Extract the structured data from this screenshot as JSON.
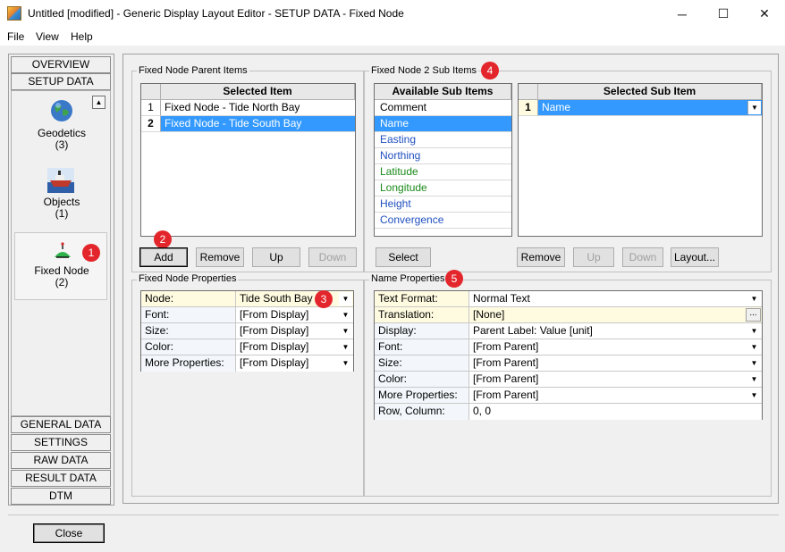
{
  "window": {
    "title": "Untitled [modified] - Generic Display Layout Editor -  SETUP DATA -  Fixed Node",
    "minimize": "─",
    "maximize": "☐",
    "close": "✕"
  },
  "menu": [
    "File",
    "View",
    "Help"
  ],
  "nav": {
    "top_tabs": [
      "OVERVIEW",
      "SETUP DATA"
    ],
    "items": [
      {
        "label": "Geodetics",
        "count": "(3)"
      },
      {
        "label": "Objects",
        "count": "(1)"
      },
      {
        "label": "Fixed Node",
        "count": "(2)"
      }
    ],
    "bottom_tabs": [
      "GENERAL DATA",
      "SETTINGS",
      "RAW DATA",
      "RESULT DATA",
      "DTM"
    ]
  },
  "badges": [
    "1",
    "2",
    "3",
    "4",
    "5"
  ],
  "parent_items": {
    "label": "Fixed Node Parent Items",
    "header": "Selected Item",
    "rows": [
      {
        "num": "1",
        "text": "Fixed Node  -  Tide North Bay"
      },
      {
        "num": "2",
        "text": "Fixed Node  -  Tide South Bay"
      }
    ],
    "buttons": {
      "add": "Add",
      "remove": "Remove",
      "up": "Up",
      "down": "Down"
    }
  },
  "sub_items": {
    "label": "Fixed Node 2 Sub Items",
    "available_header": "Available Sub Items",
    "available": [
      {
        "text": "Comment",
        "color": "#000000"
      },
      {
        "text": "Name",
        "color": "#ffffff"
      },
      {
        "text": "Easting",
        "color": "#2050c0"
      },
      {
        "text": "Northing",
        "color": "#2050c0"
      },
      {
        "text": "Latitude",
        "color": "#1a8a1a"
      },
      {
        "text": "Longitude",
        "color": "#1a8a1a"
      },
      {
        "text": "Height",
        "color": "#2050c0"
      },
      {
        "text": "Convergence",
        "color": "#2050c0"
      }
    ],
    "selected_header": "Selected Sub Item",
    "selected": [
      {
        "num": "1",
        "text": "Name"
      }
    ],
    "buttons": {
      "select": "Select",
      "remove": "Remove",
      "up": "Up",
      "down": "Down",
      "layout": "Layout..."
    }
  },
  "node_props": {
    "label": "Fixed Node Properties",
    "rows": [
      {
        "name": "Node:",
        "value": "Tide South Bay"
      },
      {
        "name": "Font:",
        "value": "[From Display]"
      },
      {
        "name": "Size:",
        "value": "[From Display]"
      },
      {
        "name": "Color:",
        "value": "[From Display]"
      },
      {
        "name": "More Properties:",
        "value": "[From Display]"
      }
    ]
  },
  "name_props": {
    "label": "Name Properties",
    "rows": [
      {
        "name": "Text Format:",
        "value": "Normal Text"
      },
      {
        "name": "Translation:",
        "value": "[None]"
      },
      {
        "name": "Display:",
        "value": "Parent Label: Value [unit]"
      },
      {
        "name": "Font:",
        "value": "[From Parent]"
      },
      {
        "name": "Size:",
        "value": "[From Parent]"
      },
      {
        "name": "Color:",
        "value": "[From Parent]"
      },
      {
        "name": "More Properties:",
        "value": "[From Parent]"
      },
      {
        "name": "Row, Column:",
        "value": "0, 0"
      }
    ]
  },
  "footer": {
    "close": "Close"
  }
}
